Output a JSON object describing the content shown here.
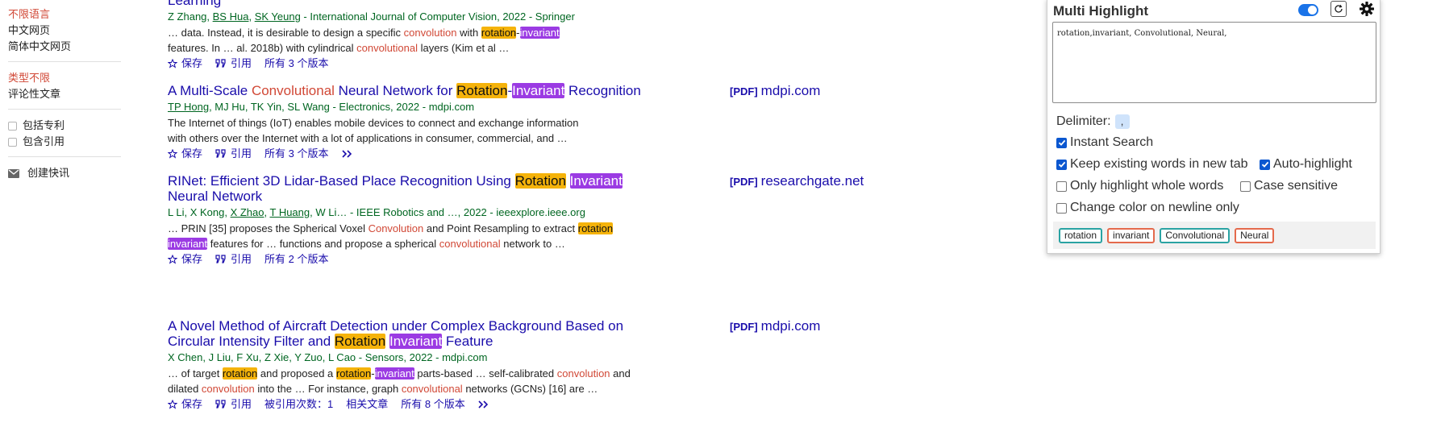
{
  "sidebar": {
    "language": [
      "不限语言",
      "中文网页",
      "简体中文网页"
    ],
    "types": [
      "类型不限",
      "评论性文章"
    ],
    "checks": [
      "包括专利",
      "包含引用"
    ],
    "alert": "创建快讯"
  },
  "actions_labels": {
    "save": "保存",
    "cite": "引用"
  },
  "results": [
    {
      "title_partial": "Learning",
      "meta": {
        "pre": "Z Zhang, ",
        "a1": "BS Hua",
        "mid": ", ",
        "a2": "SK Yeung",
        "post": " - International Journal of Computer Vision, 2022 - Springer"
      },
      "snippet1": {
        "a": "… data. Instead, it is desirable to design a specific ",
        "conv": "convolution",
        "b": " with ",
        "rot": "rotation",
        "dash": "-",
        "inv": "invariant"
      },
      "snippet2": {
        "a": "features. In … al. 2018b) with cylindrical ",
        "conv": "convolutional",
        "b": " layers (Kim et al …"
      },
      "versions": "所有 3 个版本"
    },
    {
      "title": {
        "a": "A Multi-Scale ",
        "conv": "Convolutional",
        "b": " Neural Network for ",
        "rot": "Rotation",
        "dash": "-",
        "inv": "Invariant",
        "c": " Recognition"
      },
      "meta": {
        "a1": "TP Hong",
        "post": ", MJ Hu, TK Yin, SL Wang - Electronics, 2022 - mdpi.com"
      },
      "snippet1": "The Internet of things (IoT) enables mobile devices to connect and exchange information",
      "snippet2": "with others over the Internet with a lot of applications in consumer, commercial, and …",
      "versions": "所有 3 个版本",
      "pdf": {
        "tag": "[PDF]",
        "source": "mdpi.com"
      }
    },
    {
      "title": {
        "a": "RINet: Efficient 3D Lidar-Based Place Recognition Using ",
        "rot": "Rotation",
        "sp": " ",
        "inv": "Invariant",
        "line2": "Neural Network"
      },
      "meta": {
        "pre": "L Li, X Kong, ",
        "a1": "X Zhao",
        "mid": ", ",
        "a2": "T Huang",
        "post": ", W Li… - IEEE Robotics and …, 2022 - ieeexplore.ieee.org"
      },
      "snippet1": {
        "a": "… PRIN [35] proposes the Spherical Voxel ",
        "conv": "Convolution",
        "b": " and Point Resampling to extract ",
        "rot": "rotation"
      },
      "snippet2": {
        "inv": "invariant",
        "a": " features for … functions and propose a spherical ",
        "conv": "convolutional",
        "b": " network to …"
      },
      "versions": "所有 2 个版本",
      "pdf": {
        "tag": "[PDF]",
        "source": "researchgate.net"
      }
    },
    {
      "title": {
        "a": "A Novel Method of Aircraft Detection under Complex Background Based on",
        "b": "Circular Intensity Filter and ",
        "rot": "Rotation",
        "sp": " ",
        "inv": "Invariant",
        "c": " Feature"
      },
      "meta": {
        "post": "X Chen, J Liu, F Xu, Z Xie, Y Zuo, L Cao - Sensors, 2022 - mdpi.com"
      },
      "snippet1": {
        "a": "… of target ",
        "rot": "rotation",
        "b": " and proposed a ",
        "rot2": "rotation",
        "dash": "-",
        "inv": "invariant",
        "c": " parts-based … self-calibrated ",
        "conv": "convolution",
        "d": " and"
      },
      "snippet2": {
        "a": "dilated ",
        "conv": "convolution",
        "b": " into the … For instance, graph ",
        "conv2": "convolutional",
        "c": " networks (GCNs) [16] are …"
      },
      "cited": "被引用次数：1",
      "related": "相关文章",
      "versions": "所有 8 个版本",
      "pdf": {
        "tag": "[PDF]",
        "source": "mdpi.com"
      }
    }
  ],
  "panel": {
    "title": "Multi Highlight",
    "words_value": "rotation,invariant, Convolutional, Neural,",
    "delimiter_label": "Delimiter:",
    "delimiter_value": ",",
    "options": {
      "instant_search": {
        "label": "Instant Search",
        "checked": true
      },
      "keep_existing": {
        "label": "Keep existing words in new tab",
        "checked": true
      },
      "auto_highlight": {
        "label": "Auto-highlight",
        "checked": true
      },
      "whole_words": {
        "label": "Only highlight whole words",
        "checked": false
      },
      "case_sensitive": {
        "label": "Case sensitive",
        "checked": false
      },
      "change_color": {
        "label": "Change color on newline only",
        "checked": false
      }
    },
    "chips": [
      "rotation",
      "invariant",
      "Convolutional",
      "Neural"
    ],
    "colors": {
      "toggle": "#1a73e8",
      "chip_teal": "#2aa3a3",
      "chip_orange": "#e46a4c"
    }
  },
  "colors": {
    "link": "#1a0dab",
    "meta": "#006621",
    "keyword": "#d14836",
    "hl_rotation": "#f5b30a",
    "hl_invariant": "#9b3be3"
  }
}
